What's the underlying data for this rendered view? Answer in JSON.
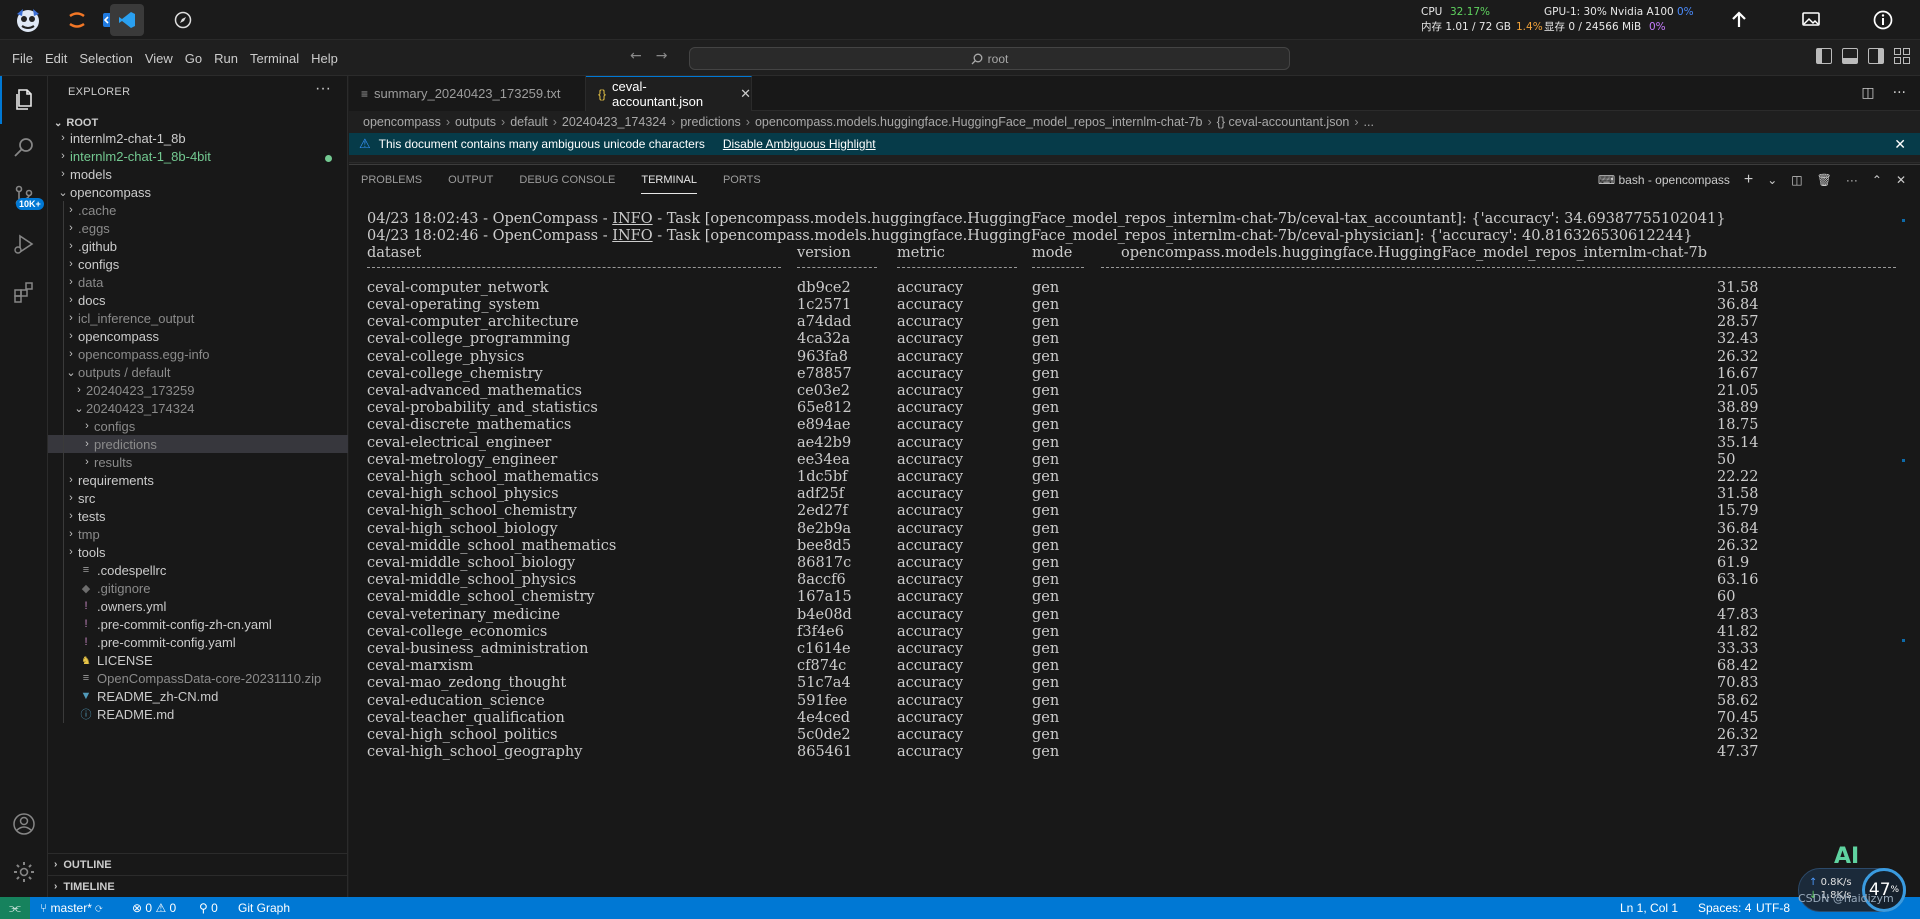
{
  "system": {
    "cpu_label": "CPU",
    "cpu_value": "32.17%",
    "mem_label": "内存 1.01 / 72 GB",
    "mem_pct": "1.4%",
    "gpu_label": "GPU-1: 30% Nvidia A100",
    "gpu_pct": "0%",
    "vram_label": "显存 0 / 24566 MiB",
    "vram_pct": "0%"
  },
  "menu": [
    "File",
    "Edit",
    "Selection",
    "View",
    "Go",
    "Run",
    "Terminal",
    "Help"
  ],
  "command_center": "root",
  "activity": {
    "source_control_badge": "10K+"
  },
  "sidebar": {
    "title": "EXPLORER",
    "root": "ROOT",
    "items": [
      {
        "label": "internlm2-chat-1_8b",
        "depth": 1,
        "kind": "folder"
      },
      {
        "label": "internlm2-chat-1_8b-4bit",
        "depth": 1,
        "kind": "folder",
        "status": "green"
      },
      {
        "label": "models",
        "depth": 1,
        "kind": "folder"
      },
      {
        "label": "opencompass",
        "depth": 1,
        "kind": "folder",
        "expanded": true
      },
      {
        "label": ".cache",
        "depth": 2,
        "kind": "folder",
        "dim": true
      },
      {
        "label": ".eggs",
        "depth": 2,
        "kind": "folder",
        "dim": true
      },
      {
        "label": ".github",
        "depth": 2,
        "kind": "folder"
      },
      {
        "label": "configs",
        "depth": 2,
        "kind": "folder"
      },
      {
        "label": "data",
        "depth": 2,
        "kind": "folder",
        "dim": true
      },
      {
        "label": "docs",
        "depth": 2,
        "kind": "folder"
      },
      {
        "label": "icl_inference_output",
        "depth": 2,
        "kind": "folder",
        "dim": true
      },
      {
        "label": "opencompass",
        "depth": 2,
        "kind": "folder"
      },
      {
        "label": "opencompass.egg-info",
        "depth": 2,
        "kind": "folder",
        "dim": true
      },
      {
        "label": "outputs / default",
        "depth": 2,
        "kind": "folder",
        "dim": true,
        "expanded": true
      },
      {
        "label": "20240423_173259",
        "depth": 3,
        "kind": "folder",
        "dim": true
      },
      {
        "label": "20240423_174324",
        "depth": 3,
        "kind": "folder",
        "dim": true,
        "expanded": true
      },
      {
        "label": "configs",
        "depth": 4,
        "kind": "folder",
        "dim": true
      },
      {
        "label": "predictions",
        "depth": 4,
        "kind": "folder",
        "dim": true,
        "selected": true
      },
      {
        "label": "results",
        "depth": 4,
        "kind": "folder",
        "dim": true
      },
      {
        "label": "requirements",
        "depth": 2,
        "kind": "folder"
      },
      {
        "label": "src",
        "depth": 2,
        "kind": "folder"
      },
      {
        "label": "tests",
        "depth": 2,
        "kind": "folder"
      },
      {
        "label": "tmp",
        "depth": 2,
        "kind": "folder",
        "dim": true
      },
      {
        "label": "tools",
        "depth": 2,
        "kind": "folder"
      },
      {
        "label": ".codespellrc",
        "depth": 2,
        "kind": "file",
        "icon": "≡"
      },
      {
        "label": ".gitignore",
        "depth": 2,
        "kind": "file",
        "icon": "◆",
        "dim": true
      },
      {
        "label": ".owners.yml",
        "depth": 2,
        "kind": "file",
        "icon": "!"
      },
      {
        "label": ".pre-commit-config-zh-cn.yaml",
        "depth": 2,
        "kind": "file",
        "icon": "!"
      },
      {
        "label": ".pre-commit-config.yaml",
        "depth": 2,
        "kind": "file",
        "icon": "!"
      },
      {
        "label": "LICENSE",
        "depth": 2,
        "kind": "file",
        "icon": "♞"
      },
      {
        "label": "OpenCompassData-core-20231110.zip",
        "depth": 2,
        "kind": "file",
        "icon": "≡",
        "dim": true
      },
      {
        "label": "README_zh-CN.md",
        "depth": 2,
        "kind": "file",
        "icon": "▼"
      },
      {
        "label": "README.md",
        "depth": 2,
        "kind": "file",
        "icon": "ⓘ"
      }
    ],
    "outline": "OUTLINE",
    "timeline": "TIMELINE"
  },
  "tabs": [
    {
      "label": "summary_20240423_173259.txt",
      "icon": "≡",
      "active": false
    },
    {
      "label": "ceval-accountant.json",
      "icon": "{}",
      "active": true
    }
  ],
  "breadcrumb": [
    "opencompass",
    "outputs",
    "default",
    "20240423_174324",
    "predictions",
    "opencompass.models.huggingface.HuggingFace_model_repos_internlm-chat-7b",
    "{} ceval-accountant.json",
    "..."
  ],
  "banner": {
    "text": "This document contains many ambiguous unicode characters",
    "link": "Disable Ambiguous Highlight"
  },
  "panel": {
    "tabs": [
      "PROBLEMS",
      "OUTPUT",
      "DEBUG CONSOLE",
      "TERMINAL",
      "PORTS"
    ],
    "active_tab": "TERMINAL",
    "terminal_name": "bash - opencompass"
  },
  "terminal": {
    "log_lines": [
      {
        "prefix": "04/23 18:02:43 - OpenCompass - ",
        "level": "INFO",
        "rest": " - Task [opencompass.models.huggingface.HuggingFace_model_repos_internlm-chat-7b/ceval-tax_accountant]: {'accuracy': 34.69387755102041}"
      },
      {
        "prefix": "04/23 18:02:46 - OpenCompass - ",
        "level": "INFO",
        "rest": " - Task [opencompass.models.huggingface.HuggingFace_model_repos_internlm-chat-7b/ceval-physician]: {'accuracy': 40.816326530612244}"
      }
    ],
    "headers": [
      "dataset",
      "version",
      "metric",
      "mode",
      "opencompass.models.huggingface.HuggingFace_model_repos_internlm-chat-7b"
    ],
    "rows": [
      [
        "ceval-computer_network",
        "db9ce2",
        "accuracy",
        "gen",
        "31.58"
      ],
      [
        "ceval-operating_system",
        "1c2571",
        "accuracy",
        "gen",
        "36.84"
      ],
      [
        "ceval-computer_architecture",
        "a74dad",
        "accuracy",
        "gen",
        "28.57"
      ],
      [
        "ceval-college_programming",
        "4ca32a",
        "accuracy",
        "gen",
        "32.43"
      ],
      [
        "ceval-college_physics",
        "963fa8",
        "accuracy",
        "gen",
        "26.32"
      ],
      [
        "ceval-college_chemistry",
        "e78857",
        "accuracy",
        "gen",
        "16.67"
      ],
      [
        "ceval-advanced_mathematics",
        "ce03e2",
        "accuracy",
        "gen",
        "21.05"
      ],
      [
        "ceval-probability_and_statistics",
        "65e812",
        "accuracy",
        "gen",
        "38.89"
      ],
      [
        "ceval-discrete_mathematics",
        "e894ae",
        "accuracy",
        "gen",
        "18.75"
      ],
      [
        "ceval-electrical_engineer",
        "ae42b9",
        "accuracy",
        "gen",
        "35.14"
      ],
      [
        "ceval-metrology_engineer",
        "ee34ea",
        "accuracy",
        "gen",
        "50"
      ],
      [
        "ceval-high_school_mathematics",
        "1dc5bf",
        "accuracy",
        "gen",
        "22.22"
      ],
      [
        "ceval-high_school_physics",
        "adf25f",
        "accuracy",
        "gen",
        "31.58"
      ],
      [
        "ceval-high_school_chemistry",
        "2ed27f",
        "accuracy",
        "gen",
        "15.79"
      ],
      [
        "ceval-high_school_biology",
        "8e2b9a",
        "accuracy",
        "gen",
        "36.84"
      ],
      [
        "ceval-middle_school_mathematics",
        "bee8d5",
        "accuracy",
        "gen",
        "26.32"
      ],
      [
        "ceval-middle_school_biology",
        "86817c",
        "accuracy",
        "gen",
        "61.9"
      ],
      [
        "ceval-middle_school_physics",
        "8accf6",
        "accuracy",
        "gen",
        "63.16"
      ],
      [
        "ceval-middle_school_chemistry",
        "167a15",
        "accuracy",
        "gen",
        "60"
      ],
      [
        "ceval-veterinary_medicine",
        "b4e08d",
        "accuracy",
        "gen",
        "47.83"
      ],
      [
        "ceval-college_economics",
        "f3f4e6",
        "accuracy",
        "gen",
        "41.82"
      ],
      [
        "ceval-business_administration",
        "c1614e",
        "accuracy",
        "gen",
        "33.33"
      ],
      [
        "ceval-marxism",
        "cf874c",
        "accuracy",
        "gen",
        "68.42"
      ],
      [
        "ceval-mao_zedong_thought",
        "51c7a4",
        "accuracy",
        "gen",
        "70.83"
      ],
      [
        "ceval-education_science",
        "591fee",
        "accuracy",
        "gen",
        "58.62"
      ],
      [
        "ceval-teacher_qualification",
        "4e4ced",
        "accuracy",
        "gen",
        "70.45"
      ],
      [
        "ceval-high_school_politics",
        "5c0de2",
        "accuracy",
        "gen",
        "26.32"
      ],
      [
        "ceval-high_school_geography",
        "865461",
        "accuracy",
        "gen",
        "47.37"
      ]
    ]
  },
  "status": {
    "branch": "master*",
    "errors": "0",
    "warnings": "0",
    "ports": "0",
    "git_graph": "Git Graph",
    "position": "Ln 1, Col 1",
    "spaces": "Spaces: 4",
    "encoding": "UTF-8"
  },
  "overlay": {
    "ai_label": "AI",
    "upload_rate": "0.8",
    "upload_unit": "K/s",
    "download_rate": "1.8",
    "download_unit": "K/s",
    "net_percent": "47",
    "watermark": "CSDN @haidizym"
  },
  "colors": {
    "accent": "#0078d4",
    "banner": "#063b49",
    "status_bar": "#0078d4",
    "remote": "#16825d"
  }
}
